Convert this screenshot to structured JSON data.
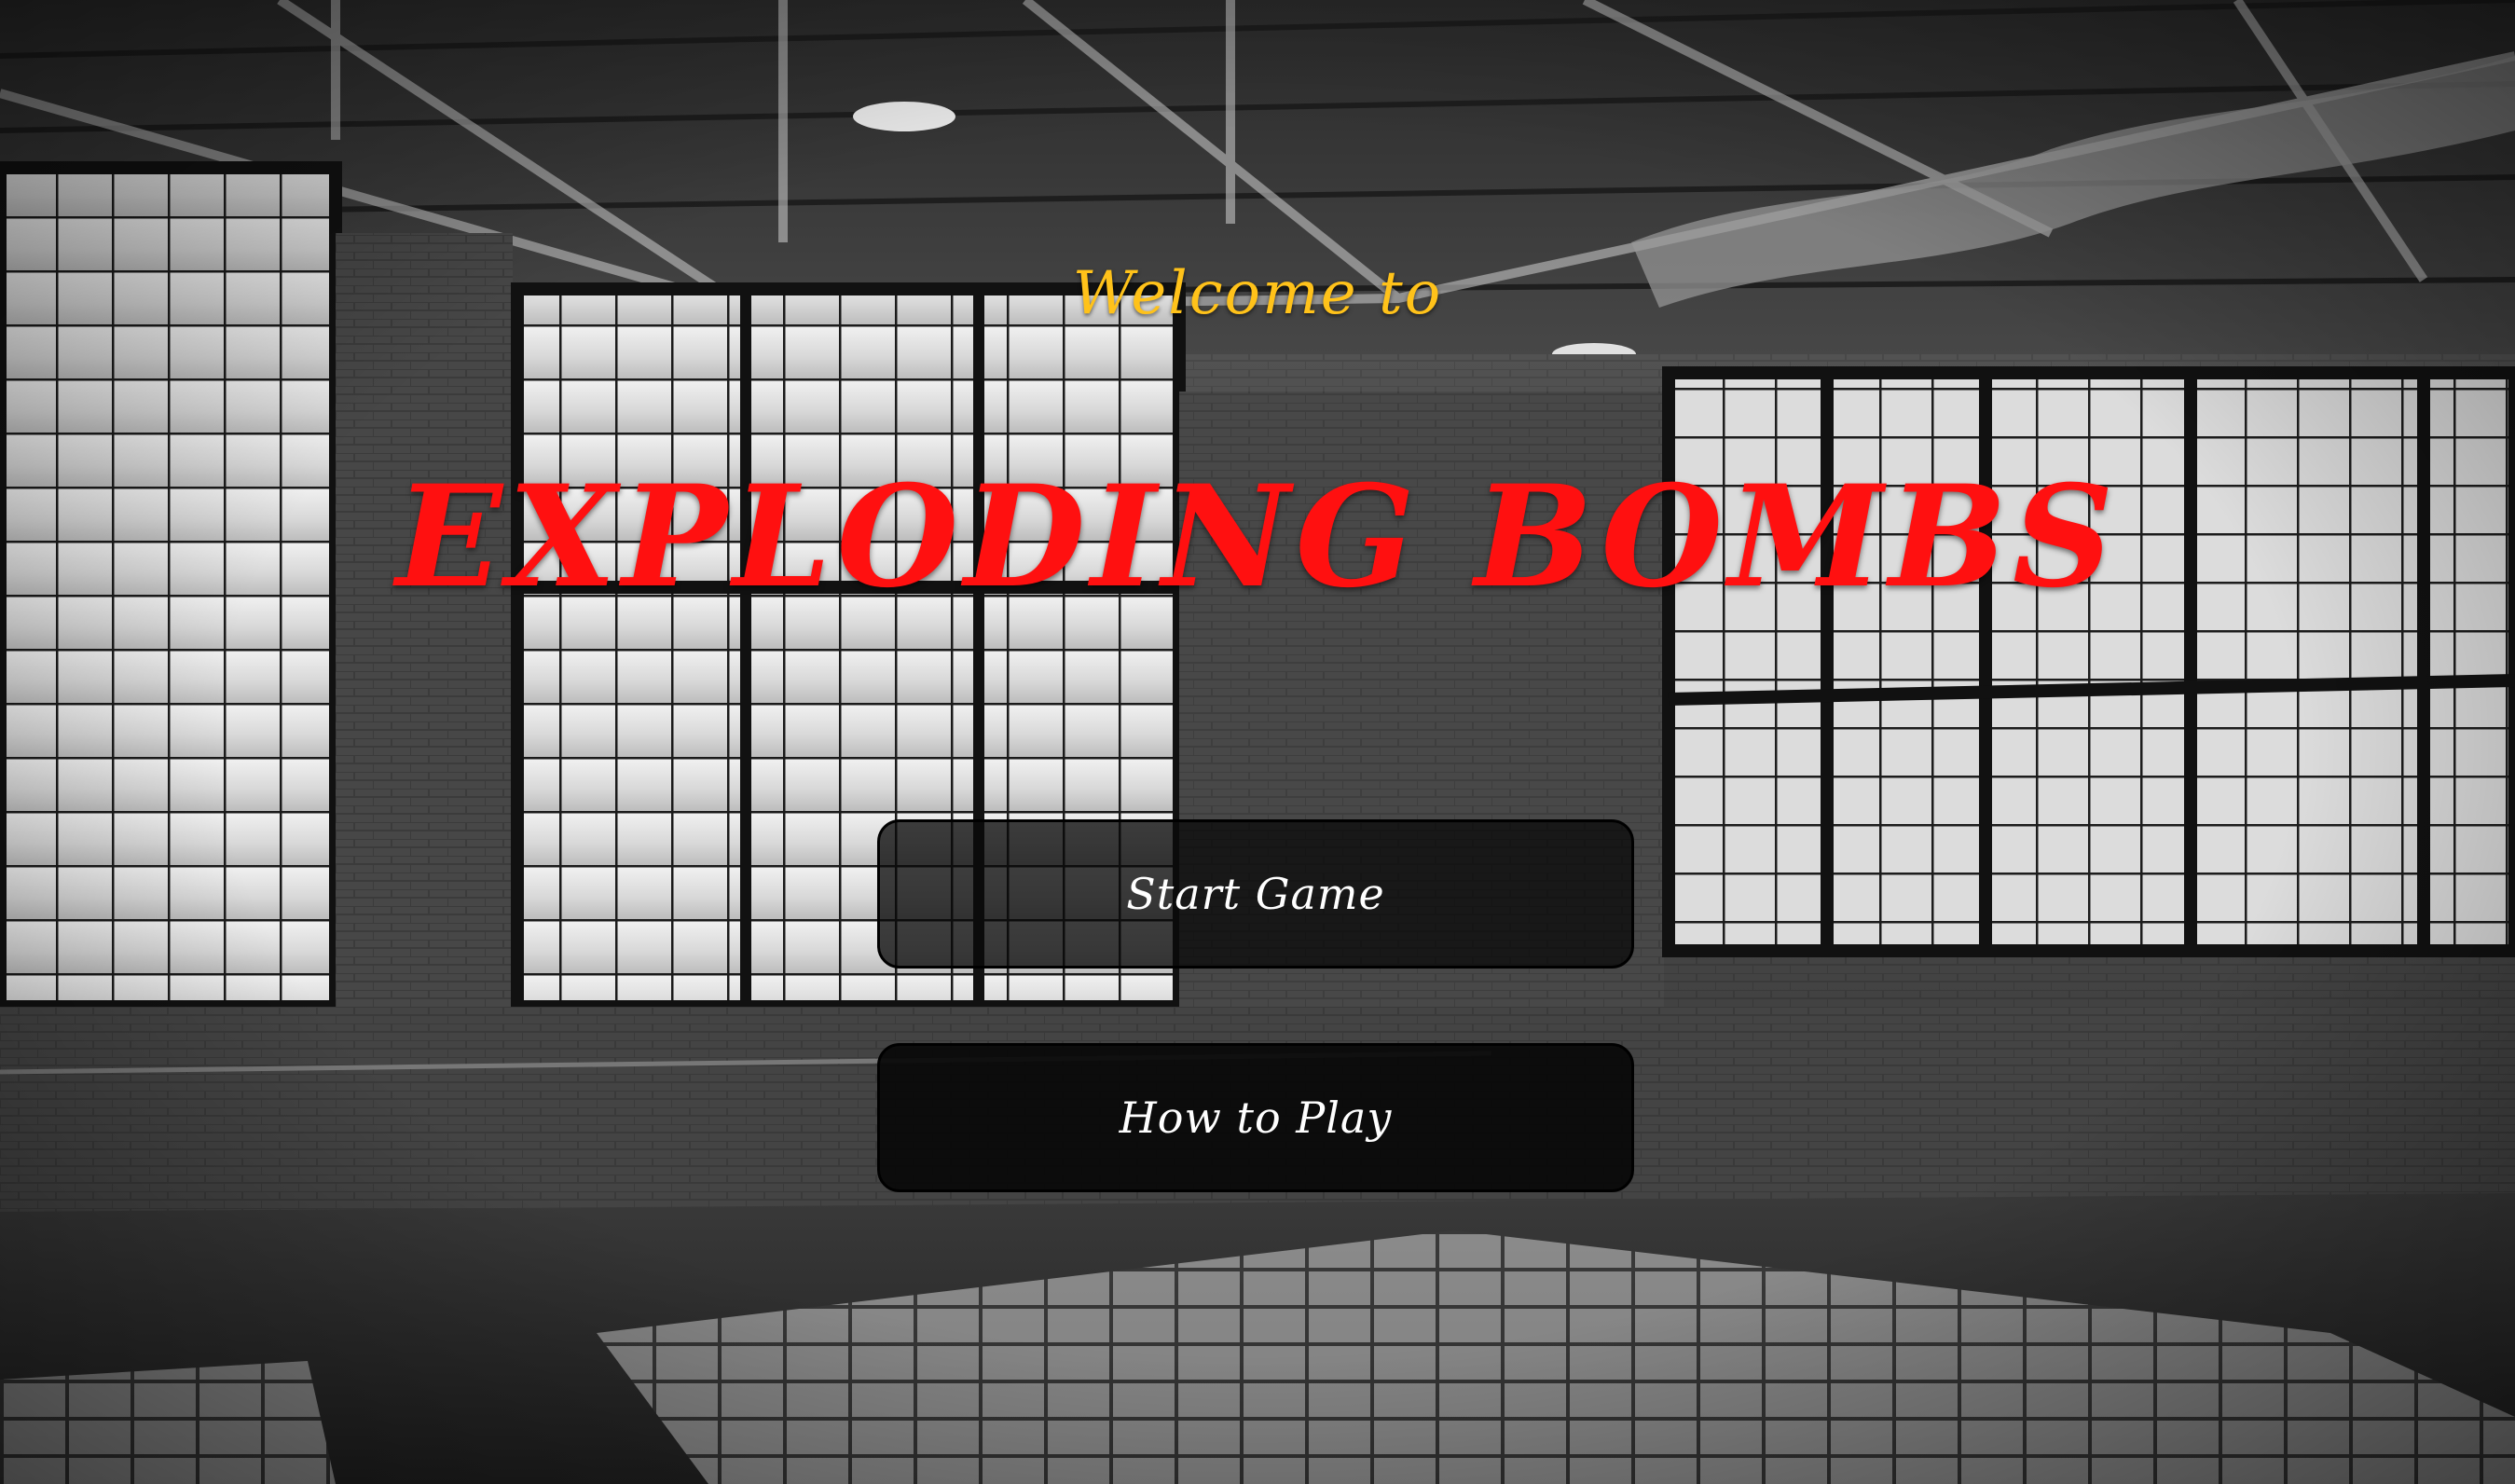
{
  "header": {
    "welcome_text": "Welcome to",
    "game_title": "EXPLODING BOMBS"
  },
  "menu": {
    "start_label": "Start Game",
    "howto_label": "How to Play"
  },
  "colors": {
    "welcome": "#ffc21a",
    "title": "#ff1010",
    "button_bg": "#0a0a0a",
    "button_text": "#ffffff"
  },
  "background": {
    "scene": "warehouse-interior-icon"
  }
}
